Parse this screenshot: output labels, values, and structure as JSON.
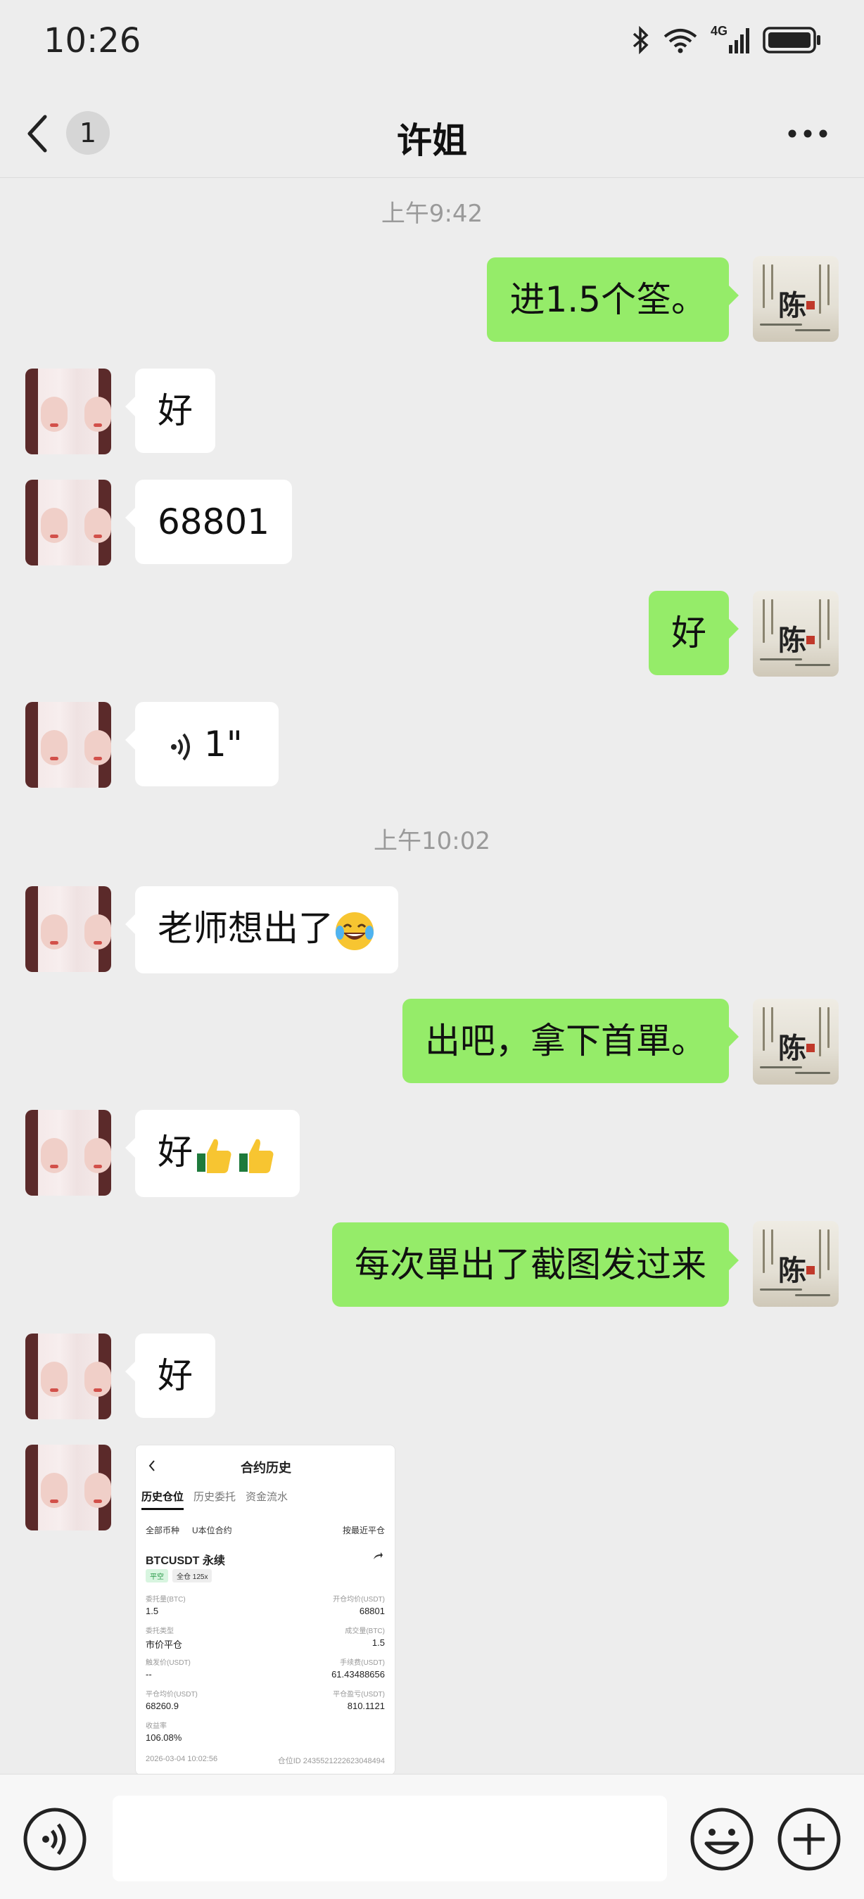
{
  "status_bar": {
    "time": "10:26",
    "icons": [
      "bluetooth-icon",
      "wifi-icon",
      "cellular-4g-icon",
      "battery-icon"
    ],
    "network_label": "4G"
  },
  "header": {
    "unread_count": "1",
    "title": "许姐",
    "more_icon": "more-icon"
  },
  "chat": {
    "time_labels": [
      "上午9:42",
      "上午10:02"
    ],
    "messages": [
      {
        "side": "right",
        "text": "进1.5个筌。"
      },
      {
        "side": "left",
        "text": "好"
      },
      {
        "side": "left",
        "text": "68801"
      },
      {
        "side": "right",
        "text": "好"
      },
      {
        "side": "left",
        "type": "voice",
        "duration": "1\""
      },
      {
        "side": "left",
        "text": "老师想出了",
        "emoji": "tears-of-joy-emoji"
      },
      {
        "side": "right",
        "text": "出吧，拿下首單。"
      },
      {
        "side": "left",
        "text": "好",
        "emoji": "thumbs-up-emoji x2"
      },
      {
        "side": "right",
        "text": "每次單出了截图发过来"
      },
      {
        "side": "left",
        "text": "好"
      },
      {
        "side": "left",
        "type": "image"
      }
    ]
  },
  "screenshot": {
    "title": "合约历史",
    "tabs": [
      "历史仓位",
      "历史委托",
      "资金流水"
    ],
    "filters": [
      "全部币种",
      "U本位合约",
      "按最近平仓"
    ],
    "symbol": "BTCUSDT 永续",
    "tags": [
      "平空",
      "全仓 125x"
    ],
    "rows": [
      {
        "l_label": "委托量(BTC)",
        "l_value": "1.5",
        "r_label": "开仓均价(USDT)",
        "r_value": "68801"
      },
      {
        "l_label": "委托类型",
        "l_value": "市价平仓",
        "r_label": "成交量(BTC)",
        "r_value": "1.5"
      },
      {
        "l_label": "触发价(USDT)",
        "l_value": "--",
        "r_label": "手续费(USDT)",
        "r_value": "61.43488656"
      },
      {
        "l_label": "平仓均价(USDT)",
        "l_value": "68260.9",
        "r_label": "平仓盈亏(USDT)",
        "r_value": "810.1121"
      },
      {
        "l_label": "收益率",
        "l_value": "106.08%",
        "r_label": "",
        "r_value": ""
      }
    ],
    "footer_time": "2026-03-04 10:02:56",
    "footer_id": "仓位ID 2435521222623048494"
  },
  "input_bar": {
    "placeholder": ""
  },
  "colors": {
    "background": "#ededed",
    "self_bubble": "#95ec69",
    "other_bubble": "#ffffff",
    "time_label": "#9a9a9a"
  }
}
